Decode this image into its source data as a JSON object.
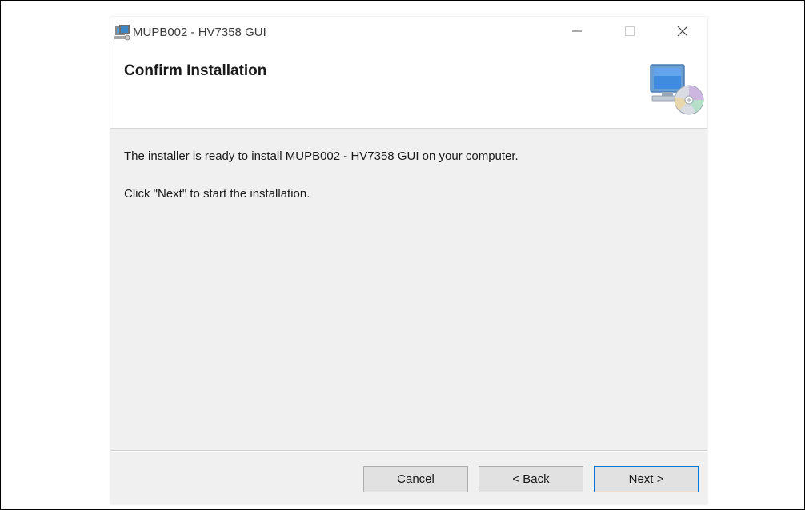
{
  "window": {
    "title": "MUPB002 - HV7358 GUI"
  },
  "banner": {
    "title": "Confirm Installation",
    "icon": "computer-cd-icon"
  },
  "content": {
    "line1": "The installer is ready to install MUPB002 - HV7358 GUI on your computer.",
    "line2": "Click \"Next\" to start the installation."
  },
  "buttons": {
    "cancel": "Cancel",
    "back": "< Back",
    "next": "Next >"
  },
  "titlebar_icons": {
    "minimize": "minimize-icon",
    "maximize": "maximize-icon",
    "close": "close-icon"
  },
  "colors": {
    "dialog_bg": "#f0f0f0",
    "default_button_border": "#0078d7"
  }
}
